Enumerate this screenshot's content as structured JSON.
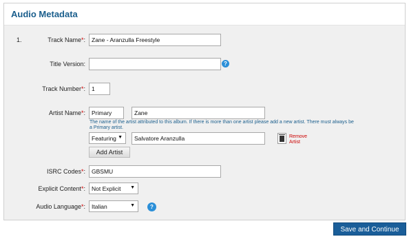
{
  "panel": {
    "title": "Audio Metadata"
  },
  "row_number": "1.",
  "labels": {
    "track_name": "Track Name",
    "title_version": "Title Version:",
    "track_number": "Track Number",
    "artist_name": "Artist Name",
    "isrc_codes": "ISRC Codes",
    "explicit_content": "Explicit Content",
    "audio_language": "Audio Language",
    "required_mark": "*",
    "colon": ":"
  },
  "fields": {
    "track_name": "Zane - Aranzulla Freestyle",
    "title_version": "",
    "track_number": "1",
    "primary_role": "Primary",
    "primary_artist": "Zane",
    "featuring_role": "Featuring",
    "featuring_artist": "Salvatore Aranzulla",
    "isrc_codes": "GBSMU",
    "explicit_content": "Not Explicit",
    "audio_language": "Italian"
  },
  "artist_hint": "The name of the artist attributed to this album. If there is more than one artist please add a new artist. There must always be a Primary artist.",
  "remove_artist": "Remove Artist",
  "buttons": {
    "add_artist": "Add Artist",
    "save_continue": "Save and Continue"
  },
  "help_glyph": "?",
  "arrow_glyph": "▼",
  "icons": {
    "help": "help-icon",
    "trash": "trash-icon",
    "dropdown": "chevron-down-icon"
  },
  "colors": {
    "title": "#1a5e8c",
    "primary_button": "#1a5e99",
    "required": "#cc0000",
    "help": "#2b8fd8"
  }
}
